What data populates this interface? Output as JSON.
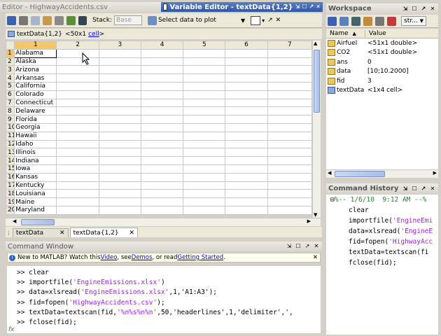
{
  "editor_title": "Editor - HighwayAccidents.csv",
  "var_editor": {
    "title": "Variable Editor - textData{1,2}",
    "stack_label": "Stack:",
    "stack_value": "Base",
    "plot_label": "Select data to plot",
    "breadcrumb": "textData{1,2}",
    "breadcrumb_meta": "<50x1",
    "breadcrumb_link": "cell",
    "breadcrumb_end": ">",
    "columns": [
      "1",
      "2",
      "3",
      "4",
      "5",
      "6",
      "7"
    ],
    "rows": [
      {
        "n": "1",
        "v": "Alabama"
      },
      {
        "n": "2",
        "v": "Alaska"
      },
      {
        "n": "3",
        "v": "Arizona"
      },
      {
        "n": "4",
        "v": "Arkansas"
      },
      {
        "n": "5",
        "v": "California"
      },
      {
        "n": "6",
        "v": "Colorado"
      },
      {
        "n": "7",
        "v": "Connecticut"
      },
      {
        "n": "8",
        "v": "Delaware"
      },
      {
        "n": "9",
        "v": "Florida"
      },
      {
        "n": "10",
        "v": "Georgia"
      },
      {
        "n": "11",
        "v": "Hawaii"
      },
      {
        "n": "12",
        "v": "Idaho"
      },
      {
        "n": "13",
        "v": "Illinois"
      },
      {
        "n": "14",
        "v": "Indiana"
      },
      {
        "n": "15",
        "v": "Iowa"
      },
      {
        "n": "16",
        "v": "Kansas"
      },
      {
        "n": "17",
        "v": "Kentucky"
      },
      {
        "n": "18",
        "v": "Louisiana"
      },
      {
        "n": "19",
        "v": "Maine"
      },
      {
        "n": "20",
        "v": "Maryland"
      }
    ],
    "tabs": [
      "textData",
      "textData{1,2}"
    ]
  },
  "workspace": {
    "title": "Workspace",
    "dropdown": "str...",
    "col_name": "Name",
    "col_value": "Value",
    "vars": [
      {
        "name": "Airfuel",
        "value": "<51x1 double>",
        "type": "array"
      },
      {
        "name": "CO2",
        "value": "<51x1 double>",
        "type": "array"
      },
      {
        "name": "ans",
        "value": "0",
        "type": "array"
      },
      {
        "name": "data",
        "value": "[10;10.2000]",
        "type": "array"
      },
      {
        "name": "fid",
        "value": "3",
        "type": "array"
      },
      {
        "name": "textData",
        "value": "<1x4 cell>",
        "type": "cell"
      }
    ]
  },
  "history": {
    "title": "Command History",
    "session": "%-- 1/6/10  9:12 AM --%",
    "entries": [
      {
        "pre": "clear",
        "str": "",
        "post": ""
      },
      {
        "pre": "importfile(",
        "str": "'EngineEmi",
        "post": ""
      },
      {
        "pre": "data=xlsread(",
        "str": "'EngineE",
        "post": ""
      },
      {
        "pre": "fid=fopen(",
        "str": "'HighwayAcc",
        "post": ""
      },
      {
        "pre": "textData=textscan(fi",
        "str": "",
        "post": ""
      },
      {
        "pre": "fclose(fid);",
        "str": "",
        "post": ""
      }
    ]
  },
  "command_window": {
    "title": "Command Window",
    "notice_pre": "New to MATLAB? Watch this ",
    "notice_link1": "Video",
    "notice_mid1": ", see ",
    "notice_link2": "Demos",
    "notice_mid2": ", or read ",
    "notice_link3": "Getting Started",
    "notice_end": ".",
    "lines": [
      {
        "prompt": ">> ",
        "pre": "clear",
        "str": "",
        "post": ""
      },
      {
        "prompt": ">> ",
        "pre": "importfile(",
        "str": "'EngineEmissions.xlsx'",
        "post": ")"
      },
      {
        "prompt": ">> ",
        "pre": "data=xlsread(",
        "str": "'EngineEmissions.xlsx'",
        "post": ",1,'A1:A3');"
      },
      {
        "prompt": ">> ",
        "pre": "fid=fopen(",
        "str": "'HighwayAccidents.csv'",
        "post": ");"
      },
      {
        "prompt": ">> ",
        "pre": "textData=textscan(fid,",
        "str": "'%n%s%n%n'",
        "post": ",50,'headerlines',1,'delimiter',',"
      },
      {
        "prompt": ">> ",
        "pre": "fclose(fid);",
        "str": "",
        "post": ""
      }
    ],
    "fx": "fx"
  },
  "colors": {
    "accent": "#2d57a6",
    "string": "#a020f0",
    "selection": "#f6c66a"
  }
}
